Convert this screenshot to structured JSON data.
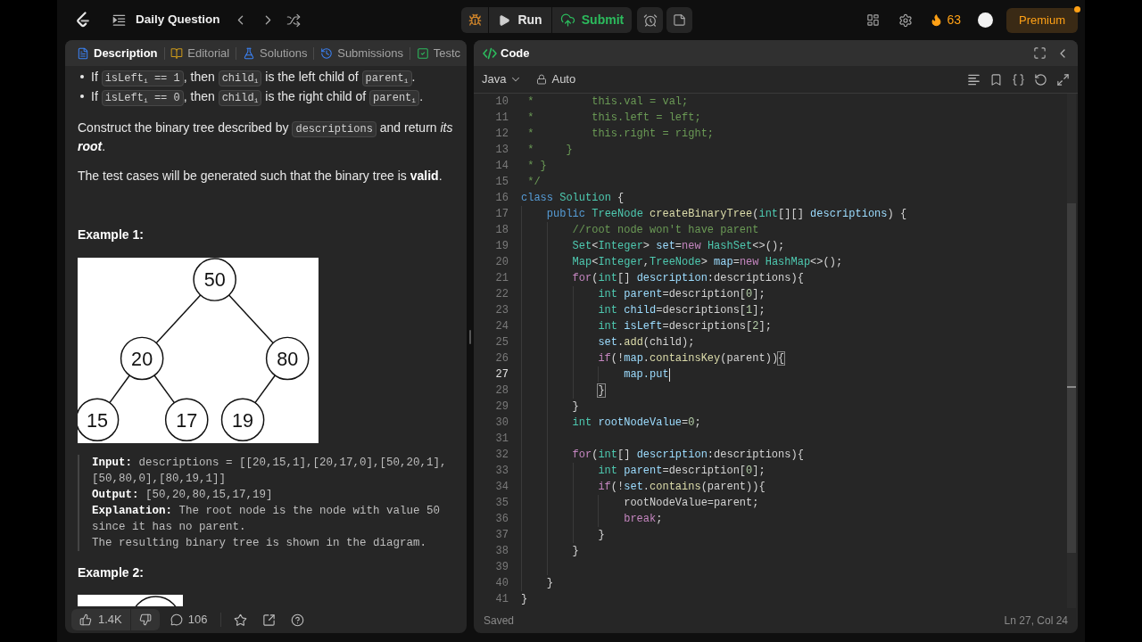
{
  "top_bar": {
    "title": "Daily Question",
    "run_label": "Run",
    "submit_label": "Submit",
    "streak": "63",
    "premium_label": "Premium",
    "premium_notification": true
  },
  "description_panel": {
    "tabs": [
      {
        "kind": "description",
        "label": "Description",
        "selected": true
      },
      {
        "kind": "editorial",
        "label": "Editorial",
        "selected": false
      },
      {
        "kind": "solutions",
        "label": "Solutions",
        "selected": false
      },
      {
        "kind": "submissions",
        "label": "Submissions",
        "selected": false
      },
      {
        "kind": "testcase",
        "label": "Testc",
        "selected": false
      }
    ],
    "content": [
      {
        "kind": "bullet",
        "segments": [
          {
            "kind": "text",
            "text": "If "
          },
          {
            "kind": "code",
            "text": "isLeft$_{i}$ == 1"
          },
          {
            "kind": "text",
            "text": ", then "
          },
          {
            "kind": "code",
            "text": "child$_{i}$"
          },
          {
            "kind": "text",
            "text": " is the left child of "
          },
          {
            "kind": "code",
            "text": "parent$_{i}$"
          },
          {
            "kind": "text",
            "text": "."
          }
        ]
      },
      {
        "kind": "bullet",
        "segments": [
          {
            "kind": "text",
            "text": "If "
          },
          {
            "kind": "code",
            "text": "isLeft$_{i}$ == 0"
          },
          {
            "kind": "text",
            "text": ", then "
          },
          {
            "kind": "code",
            "text": "child$_{i}$"
          },
          {
            "kind": "text",
            "text": " is the right child of "
          },
          {
            "kind": "code",
            "text": "parent$_{i}$"
          },
          {
            "kind": "text",
            "text": "."
          }
        ]
      },
      {
        "kind": "paragraph",
        "segments": [
          {
            "kind": "text",
            "text": "Construct the binary tree described by "
          },
          {
            "kind": "code",
            "text": "descriptions"
          },
          {
            "kind": "text",
            "text": " and return *its* "
          },
          {
            "kind": "emphasis",
            "text": "root"
          },
          {
            "kind": "text",
            "text": "."
          }
        ]
      },
      {
        "kind": "paragraph",
        "segments": [
          {
            "kind": "text",
            "text": "The test cases will be generated such that the binary tree is **valid**."
          }
        ]
      },
      {
        "kind": "heading",
        "text": "Example 1:"
      },
      {
        "kind": "tree",
        "root": {
          "value": "50",
          "left": {
            "value": "20",
            "left": {
              "value": "15"
            },
            "right": {
              "value": "17"
            }
          },
          "right": {
            "value": "80",
            "left": {
              "value": "19"
            }
          }
        }
      },
      {
        "kind": "example",
        "lines": [
          "**Input:** descriptions = [[20,15,1],[20,17,0],[50,20,1],[50,80,0],[80,19,1]]",
          "**Output:** [50,20,80,15,17,19]",
          "**Explanation:** The root node is the node with value 50 since it has no parent.\nThe resulting binary tree is shown in the diagram."
        ]
      },
      {
        "kind": "heading",
        "text": "Example 2:"
      },
      {
        "kind": "diagram_preview"
      }
    ],
    "footer": {
      "likes": "1.4K",
      "comments": "106"
    }
  },
  "code_panel": {
    "title": "Code",
    "language": "Java",
    "mode": "Auto",
    "lines": [
      {
        "number": "10",
        "active": false,
        "tokens": [
          {
            "kind": "comment",
            "text": " *         this.val = val;"
          }
        ]
      },
      {
        "number": "11",
        "active": false,
        "tokens": [
          {
            "kind": "comment",
            "text": " *         this.left = left;"
          }
        ]
      },
      {
        "number": "12",
        "active": false,
        "tokens": [
          {
            "kind": "comment",
            "text": " *         this.right = right;"
          }
        ]
      },
      {
        "number": "13",
        "active": false,
        "tokens": [
          {
            "kind": "comment",
            "text": " *     }"
          }
        ]
      },
      {
        "number": "14",
        "active": false,
        "tokens": [
          {
            "kind": "comment",
            "text": " * }"
          }
        ]
      },
      {
        "number": "15",
        "active": false,
        "tokens": [
          {
            "kind": "comment",
            "text": " */"
          }
        ]
      },
      {
        "number": "16",
        "active": false,
        "tokens": [
          {
            "kind": "keyword",
            "text": "class "
          },
          {
            "kind": "type",
            "text": "Solution"
          },
          {
            "kind": "plain",
            "text": " {"
          }
        ]
      },
      {
        "number": "17",
        "active": false,
        "tokens": [
          {
            "kind": "keyword",
            "text": "    public "
          },
          {
            "kind": "type",
            "text": "TreeNode "
          },
          {
            "kind": "function",
            "text": "createBinaryTree"
          },
          {
            "kind": "plain",
            "text": "("
          },
          {
            "kind": "type",
            "text": "int"
          },
          {
            "kind": "plain",
            "text": "[][] "
          },
          {
            "kind": "variable",
            "text": "descriptions"
          },
          {
            "kind": "plain",
            "text": ") {"
          }
        ]
      },
      {
        "number": "18",
        "active": false,
        "tokens": [
          {
            "kind": "comment",
            "text": "        //root node won't have parent"
          }
        ]
      },
      {
        "number": "19",
        "active": false,
        "tokens": [
          {
            "kind": "type",
            "text": "        Set"
          },
          {
            "kind": "plain",
            "text": "<"
          },
          {
            "kind": "type",
            "text": "Integer"
          },
          {
            "kind": "plain",
            "text": "> "
          },
          {
            "kind": "variable",
            "text": "set"
          },
          {
            "kind": "plain",
            "text": "="
          },
          {
            "kind": "control",
            "text": "new "
          },
          {
            "kind": "type",
            "text": "HashSet"
          },
          {
            "kind": "plain",
            "text": "<>();"
          }
        ]
      },
      {
        "number": "20",
        "active": false,
        "tokens": [
          {
            "kind": "type",
            "text": "        Map"
          },
          {
            "kind": "plain",
            "text": "<"
          },
          {
            "kind": "type",
            "text": "Integer"
          },
          {
            "kind": "plain",
            "text": ","
          },
          {
            "kind": "type",
            "text": "TreeNode"
          },
          {
            "kind": "plain",
            "text": "> "
          },
          {
            "kind": "variable",
            "text": "map"
          },
          {
            "kind": "plain",
            "text": "="
          },
          {
            "kind": "control",
            "text": "new "
          },
          {
            "kind": "type",
            "text": "HashMap"
          },
          {
            "kind": "plain",
            "text": "<>();"
          }
        ]
      },
      {
        "number": "21",
        "active": false,
        "tokens": [
          {
            "kind": "control",
            "text": "        for"
          },
          {
            "kind": "plain",
            "text": "("
          },
          {
            "kind": "type",
            "text": "int"
          },
          {
            "kind": "plain",
            "text": "[] "
          },
          {
            "kind": "variable",
            "text": "description"
          },
          {
            "kind": "plain",
            "text": ":descriptions){"
          }
        ]
      },
      {
        "number": "22",
        "active": false,
        "tokens": [
          {
            "kind": "type",
            "text": "            int "
          },
          {
            "kind": "variable",
            "text": "parent"
          },
          {
            "kind": "plain",
            "text": "=description["
          },
          {
            "kind": "number",
            "text": "0"
          },
          {
            "kind": "plain",
            "text": "];"
          }
        ]
      },
      {
        "number": "23",
        "active": false,
        "tokens": [
          {
            "kind": "type",
            "text": "            int "
          },
          {
            "kind": "variable",
            "text": "child"
          },
          {
            "kind": "plain",
            "text": "=descriptions["
          },
          {
            "kind": "number",
            "text": "1"
          },
          {
            "kind": "plain",
            "text": "];"
          }
        ]
      },
      {
        "number": "24",
        "active": false,
        "tokens": [
          {
            "kind": "type",
            "text": "            int "
          },
          {
            "kind": "variable",
            "text": "isLeft"
          },
          {
            "kind": "plain",
            "text": "=descriptions["
          },
          {
            "kind": "number",
            "text": "2"
          },
          {
            "kind": "plain",
            "text": "];"
          }
        ]
      },
      {
        "number": "25",
        "active": false,
        "tokens": [
          {
            "kind": "variable",
            "text": "            set"
          },
          {
            "kind": "plain",
            "text": "."
          },
          {
            "kind": "function",
            "text": "add"
          },
          {
            "kind": "plain",
            "text": "(child);"
          }
        ]
      },
      {
        "number": "26",
        "active": false,
        "tokens": [
          {
            "kind": "control",
            "text": "            if"
          },
          {
            "kind": "plain",
            "text": "(!"
          },
          {
            "kind": "variable",
            "text": "map"
          },
          {
            "kind": "plain",
            "text": "."
          },
          {
            "kind": "function",
            "text": "containsKey"
          },
          {
            "kind": "plain",
            "text": "(parent))"
          },
          {
            "kind": "bracket",
            "text": "{"
          }
        ]
      },
      {
        "number": "27",
        "active": true,
        "tokens": [
          {
            "kind": "variable",
            "text": "                map.put"
          }
        ]
      },
      {
        "number": "28",
        "active": false,
        "tokens": [
          {
            "kind": "bracket",
            "text": "            }"
          }
        ]
      },
      {
        "number": "29",
        "active": false,
        "tokens": [
          {
            "kind": "plain",
            "text": "        }"
          }
        ]
      },
      {
        "number": "30",
        "active": false,
        "tokens": [
          {
            "kind": "type",
            "text": "        int "
          },
          {
            "kind": "variable",
            "text": "rootNodeValue"
          },
          {
            "kind": "plain",
            "text": "="
          },
          {
            "kind": "number",
            "text": "0"
          },
          {
            "kind": "plain",
            "text": ";"
          }
        ]
      },
      {
        "number": "31",
        "active": false
      },
      {
        "number": "32",
        "active": false,
        "tokens": [
          {
            "kind": "control",
            "text": "        for"
          },
          {
            "kind": "plain",
            "text": "("
          },
          {
            "kind": "type",
            "text": "int"
          },
          {
            "kind": "plain",
            "text": "[] "
          },
          {
            "kind": "variable",
            "text": "description"
          },
          {
            "kind": "plain",
            "text": ":descriptions){"
          }
        ]
      },
      {
        "number": "33",
        "active": false,
        "tokens": [
          {
            "kind": "type",
            "text": "            int "
          },
          {
            "kind": "variable",
            "text": "parent"
          },
          {
            "kind": "plain",
            "text": "=description["
          },
          {
            "kind": "number",
            "text": "0"
          },
          {
            "kind": "plain",
            "text": "];"
          }
        ]
      },
      {
        "number": "34",
        "active": false,
        "tokens": [
          {
            "kind": "control",
            "text": "            if"
          },
          {
            "kind": "plain",
            "text": "(!"
          },
          {
            "kind": "variable",
            "text": "set"
          },
          {
            "kind": "plain",
            "text": "."
          },
          {
            "kind": "function",
            "text": "contains"
          },
          {
            "kind": "plain",
            "text": "(parent)){"
          }
        ]
      },
      {
        "number": "35",
        "active": false,
        "tokens": [
          {
            "kind": "plain",
            "text": "                rootNodeValue=parent;"
          }
        ]
      },
      {
        "number": "36",
        "active": false,
        "tokens": [
          {
            "kind": "control",
            "text": "                break"
          },
          {
            "kind": "plain",
            "text": ";"
          }
        ]
      },
      {
        "number": "37",
        "active": false,
        "tokens": [
          {
            "kind": "plain",
            "text": "            }"
          }
        ]
      },
      {
        "number": "38",
        "active": false,
        "tokens": [
          {
            "kind": "plain",
            "text": "        }"
          }
        ]
      },
      {
        "number": "39",
        "active": false
      },
      {
        "number": "40",
        "active": false,
        "tokens": [
          {
            "kind": "plain",
            "text": "    }"
          }
        ]
      },
      {
        "number": "41",
        "active": false,
        "tokens": [
          {
            "kind": "plain",
            "text": "}"
          }
        ]
      }
    ],
    "status": "Saved",
    "cursor_position": "Ln 27, Col 24"
  }
}
